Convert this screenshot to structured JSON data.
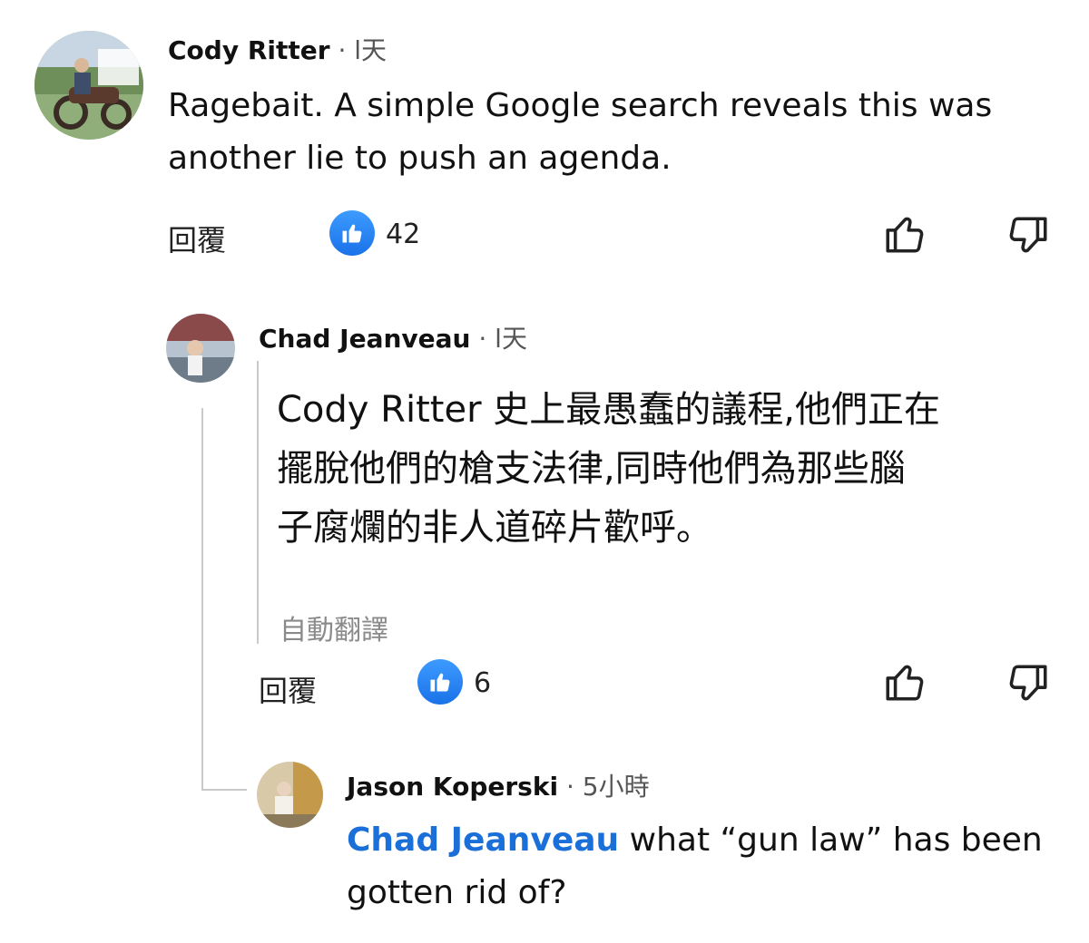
{
  "comments": [
    {
      "author": "Cody Ritter",
      "time": " · l天",
      "text_line1": "Ragebait. A simple Google search reveals this was",
      "text_line2": "another lie to push an agenda.",
      "reply_label": "回覆",
      "like_count": "42"
    },
    {
      "author": "Chad Jeanveau",
      "time": " · l天",
      "mention": "Cody Ritter",
      "text_line1": " 史上最愚蠢的議程,他們正在",
      "text_line2": "擺脫他們的槍支法律,同時他們為那些腦",
      "text_line3": "子腐爛的非人道碎片歡呼。",
      "auto_translate": "自動翻譯",
      "reply_label": "回覆",
      "like_count": "6"
    },
    {
      "author": "Jason Koperski",
      "time": " · 5小時",
      "mention": "Chad Jeanveau",
      "text_line1": " what “gun law” has been",
      "text_line2": "gotten rid of?"
    }
  ],
  "colors": {
    "mention": "#1a6fd8",
    "like_badge": "#1a72e8"
  },
  "icons": [
    "like-badge-icon",
    "thumbs-up-icon",
    "thumbs-down-icon"
  ]
}
